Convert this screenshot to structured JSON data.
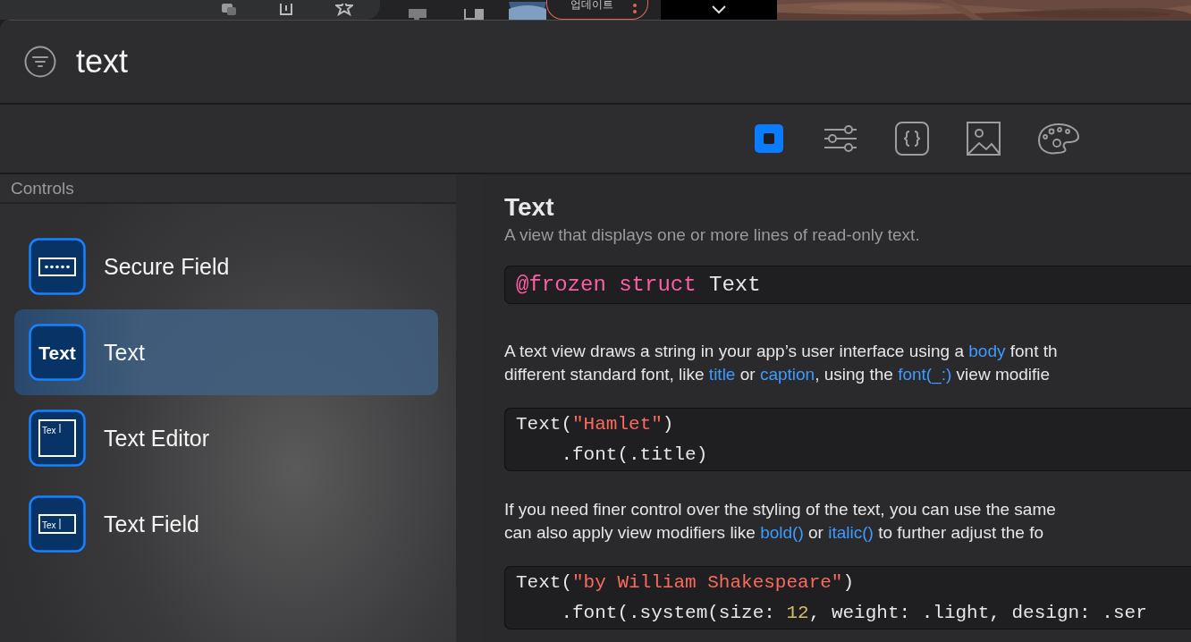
{
  "browser_bar": {
    "update_button": "업데이트"
  },
  "search": {
    "value": "text"
  },
  "library_tabs": [
    {
      "kind": "views",
      "selected": true
    },
    {
      "kind": "modifiers",
      "selected": false
    },
    {
      "kind": "snippets",
      "selected": false
    },
    {
      "kind": "media",
      "selected": false
    },
    {
      "kind": "colors",
      "selected": false
    }
  ],
  "sidebar": {
    "header": "Controls",
    "items": [
      {
        "label": "Secure Field",
        "kind": "secure",
        "selected": false
      },
      {
        "label": "Text",
        "kind": "text",
        "icon_text": "Text",
        "selected": true
      },
      {
        "label": "Text Editor",
        "kind": "editor",
        "icon_text": "Tex",
        "selected": false
      },
      {
        "label": "Text Field",
        "kind": "field",
        "icon_text": "Tex",
        "selected": false
      }
    ]
  },
  "detail": {
    "title": "Text",
    "subtitle": "A view that displays one or more lines of read-only text.",
    "blocks": [
      {
        "kind": "declaration",
        "lines": [
          [
            {
              "kind": "keyword",
              "text": "@frozen struct"
            },
            {
              "kind": "plain",
              "text": " Text"
            }
          ]
        ]
      },
      {
        "kind": "paragraph",
        "lines": [
          [
            {
              "kind": "plain",
              "text": "A text view draws a string in your app’s user interface using a "
            },
            {
              "kind": "link",
              "text": "body"
            },
            {
              "kind": "plain",
              "text": " font th"
            }
          ],
          [
            {
              "kind": "plain",
              "text": "different standard font, like "
            },
            {
              "kind": "link",
              "text": "title"
            },
            {
              "kind": "plain",
              "text": " or "
            },
            {
              "kind": "link",
              "text": "caption"
            },
            {
              "kind": "plain",
              "text": ", using the "
            },
            {
              "kind": "link",
              "text": "font(_:)"
            },
            {
              "kind": "plain",
              "text": " view modifie"
            }
          ]
        ]
      },
      {
        "kind": "code",
        "lines": [
          [
            {
              "kind": "plain",
              "text": "Text("
            },
            {
              "kind": "string",
              "text": "\"Hamlet\""
            },
            {
              "kind": "plain",
              "text": ")"
            }
          ],
          [
            {
              "kind": "plain",
              "text": "    .font(.title)"
            }
          ]
        ]
      },
      {
        "kind": "paragraph",
        "lines": [
          [
            {
              "kind": "plain",
              "text": "If you need finer control over the styling of the text, you can use the same"
            }
          ],
          [
            {
              "kind": "plain",
              "text": "can also apply view modifiers like "
            },
            {
              "kind": "link",
              "text": "bold()"
            },
            {
              "kind": "plain",
              "text": " or "
            },
            {
              "kind": "link",
              "text": "italic()"
            },
            {
              "kind": "plain",
              "text": " to further adjust the fo"
            }
          ]
        ]
      },
      {
        "kind": "code",
        "lines": [
          [
            {
              "kind": "plain",
              "text": "Text("
            },
            {
              "kind": "string",
              "text": "\"by William Shakespeare\""
            },
            {
              "kind": "plain",
              "text": ")"
            }
          ],
          [
            {
              "kind": "plain",
              "text": "    .font(.system(size: "
            },
            {
              "kind": "number",
              "text": "12"
            },
            {
              "kind": "plain",
              "text": ", weight: .light, design: .ser"
            }
          ]
        ]
      }
    ]
  }
}
